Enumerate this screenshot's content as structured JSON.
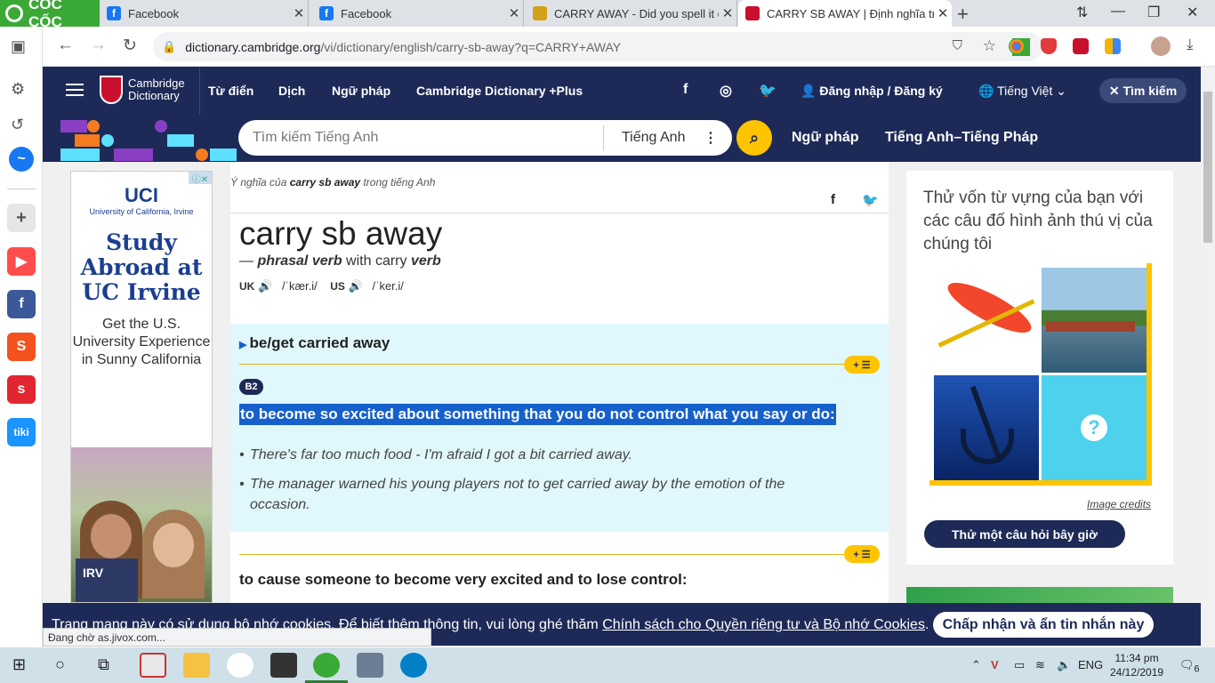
{
  "browser": {
    "brand": "CỐC CỐC",
    "tabs": [
      {
        "title": "Facebook",
        "icon": "facebook-icon"
      },
      {
        "title": "Facebook",
        "icon": "facebook-icon"
      },
      {
        "title": "CARRY AWAY - Did you spell it cor",
        "icon": "puzzle-icon"
      },
      {
        "title": "CARRY SB AWAY | Định nghĩa trong",
        "icon": "cambridge-icon"
      }
    ],
    "url_host": "dictionary.cambridge.org",
    "url_path": "/vi/dictionary/english/carry-sb-away?q=CARRY+AWAY",
    "status": "Đang chờ as.jivox.com..."
  },
  "header": {
    "logo_line1": "Cambridge",
    "logo_line2": "Dictionary",
    "nav": [
      "Từ điển",
      "Dịch",
      "Ngữ pháp",
      "Cambridge Dictionary +Plus"
    ],
    "login": "Đăng nhập / Đăng ký",
    "language": "Tiếng Việt",
    "search_button": "Tìm kiếm"
  },
  "search": {
    "placeholder": "Tìm kiếm Tiếng Anh",
    "dictionary": "Tiếng Anh",
    "links": [
      "Ngữ pháp",
      "Tiếng Anh–Tiếng Pháp"
    ]
  },
  "ad": {
    "brand": "UCI",
    "subtitle": "University of California, Irvine",
    "headline": "Study Abroad at UC Irvine",
    "body": "Get the U.S. University Experience in Sunny California",
    "shirt": "IRV"
  },
  "entry": {
    "breadcrumb_pre": "Ý nghĩa của ",
    "breadcrumb_word": "carry sb away",
    "breadcrumb_post": " trong tiếng Anh",
    "headword": "carry sb away",
    "pos_prefix": "— ",
    "pos": "phrasal verb",
    "pos_with": " with carry ",
    "pos_verb": "verb",
    "uk_label": "UK",
    "uk_ipa": "/ˈkær.i/",
    "us_label": "US",
    "us_ipa": "/ˈker.i/",
    "guideword": "be/get carried away",
    "level": "B2",
    "definition": "to become so excited about something that you do not control what you say or do:",
    "examples": [
      "There's far too much food - I'm afraid I got a bit carried away.",
      "The manager warned his young players not to get carried away by the emotion of the occasion."
    ],
    "definition2": "to cause someone to become very excited and to lose control:",
    "add_label": "+ ☰"
  },
  "quiz": {
    "title": "Thử vốn từ vựng của bạn với các câu đố hình ảnh thú vị của chúng tôi",
    "credits": "Image credits",
    "button": "Thử một câu hỏi bây giờ",
    "question_mark": "?"
  },
  "cookie": {
    "text": "Trang mạng này có sử dụng bộ nhớ cookies. Để biết thêm thông tin, vui lòng ghé thăm ",
    "link": "Chính sách cho Quyền riêng tư và Bộ nhớ Cookies",
    "end": ".",
    "accept": "Chấp nhận và ẩn tin nhắn này"
  },
  "taskbar": {
    "lang": "ENG",
    "time": "11:34 pm",
    "date": "24/12/2019",
    "notifications": "6"
  },
  "colors": {
    "brand_navy": "#1d2a57",
    "accent_yellow": "#fec400",
    "sense_bg": "#e0f8fc",
    "highlight": "#1660cc"
  }
}
